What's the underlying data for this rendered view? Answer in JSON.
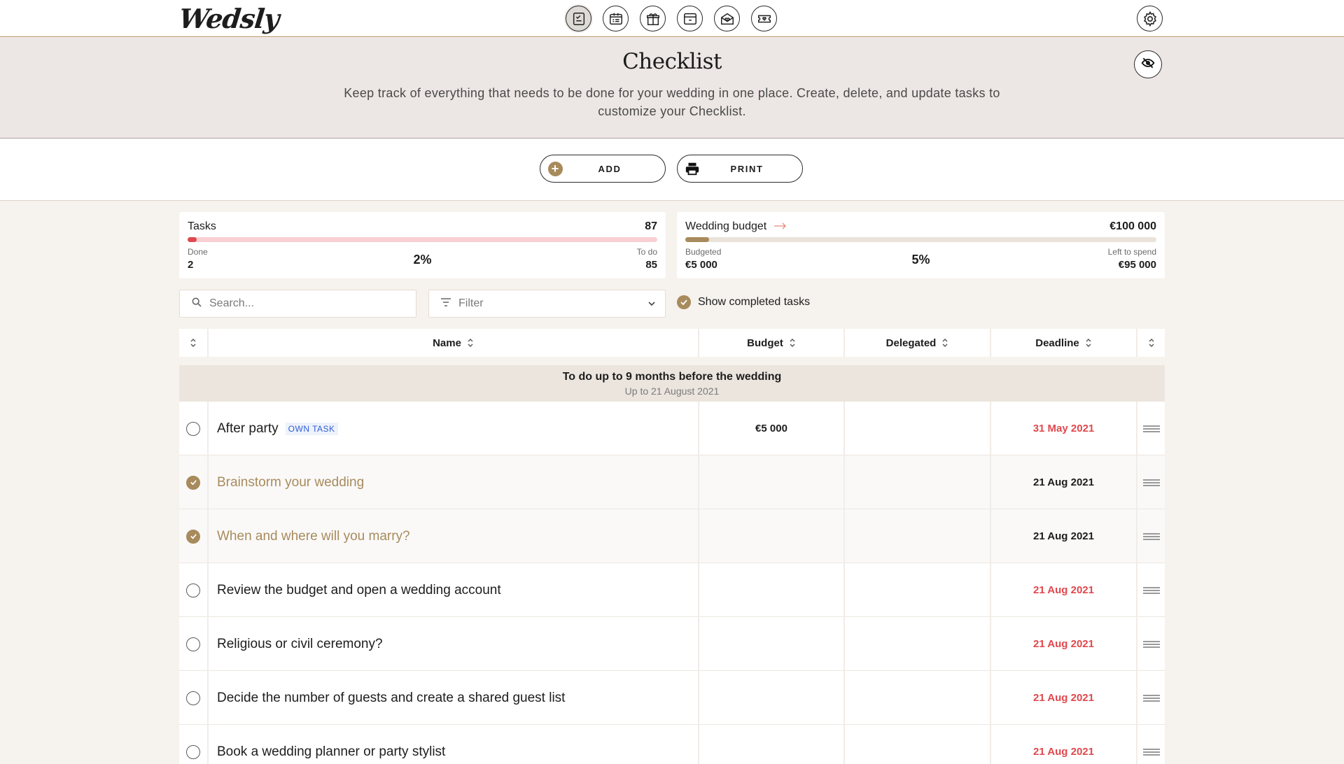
{
  "app": {
    "logo": "Wedsly"
  },
  "nav": {
    "icons": [
      "checklist-icon",
      "guestlist-icon",
      "gift-icon",
      "seating-icon",
      "invitation-icon",
      "ticket-icon"
    ],
    "settings_icon": "gear-icon"
  },
  "header": {
    "title": "Checklist",
    "description": "Keep track of everything that needs to be done for your wedding in one place. Create, delete, and update tasks to customize your Checklist."
  },
  "actions": {
    "add_label": "ADD",
    "print_label": "PRINT"
  },
  "tasks_card": {
    "title": "Tasks",
    "total": "87",
    "done_label": "Done",
    "done_value": "2",
    "todo_label": "To do",
    "todo_value": "85",
    "percent": "2%",
    "progress": 0.02
  },
  "budget_card": {
    "title": "Wedding budget",
    "total": "€100 000",
    "budgeted_label": "Budgeted",
    "budgeted_value": "€5 000",
    "left_label": "Left to spend",
    "left_value": "€95 000",
    "percent": "5%",
    "progress": 0.05
  },
  "filters": {
    "search_placeholder": "Search...",
    "filter_placeholder": "Filter",
    "show_completed": "Show completed tasks"
  },
  "table": {
    "columns": {
      "name": "Name",
      "budget": "Budget",
      "delegated": "Delegated",
      "deadline": "Deadline"
    },
    "group": {
      "title": "To do up to 9 months before the wedding",
      "subtitle": "Up to 21 August 2021"
    },
    "rows": [
      {
        "name": "After party",
        "tag": "OWN TASK",
        "budget": "€5 000",
        "delegated": "",
        "deadline": "31 May 2021",
        "done": false,
        "late": true
      },
      {
        "name": "Brainstorm your wedding",
        "tag": "",
        "budget": "",
        "delegated": "",
        "deadline": "21 Aug 2021",
        "done": true,
        "late": false
      },
      {
        "name": "When and where will you marry?",
        "tag": "",
        "budget": "",
        "delegated": "",
        "deadline": "21 Aug 2021",
        "done": true,
        "late": false
      },
      {
        "name": "Review the budget and open a wedding account",
        "tag": "",
        "budget": "",
        "delegated": "",
        "deadline": "21 Aug 2021",
        "done": false,
        "late": true
      },
      {
        "name": "Religious or civil ceremony?",
        "tag": "",
        "budget": "",
        "delegated": "",
        "deadline": "21 Aug 2021",
        "done": false,
        "late": true
      },
      {
        "name": "Decide the number of guests and create a shared guest list",
        "tag": "",
        "budget": "",
        "delegated": "",
        "deadline": "21 Aug 2021",
        "done": false,
        "late": true
      },
      {
        "name": "Book a wedding planner or party stylist",
        "tag": "",
        "budget": "",
        "delegated": "",
        "deadline": "21 Aug 2021",
        "done": false,
        "late": true
      }
    ]
  },
  "colors": {
    "accent": "#a88b5c",
    "late": "#e0484d",
    "tasks_bar": "#f6c8cd",
    "tasks_fill": "#e0484d",
    "budget_bar": "#e8e2d9",
    "budget_fill": "#a88b5c"
  }
}
